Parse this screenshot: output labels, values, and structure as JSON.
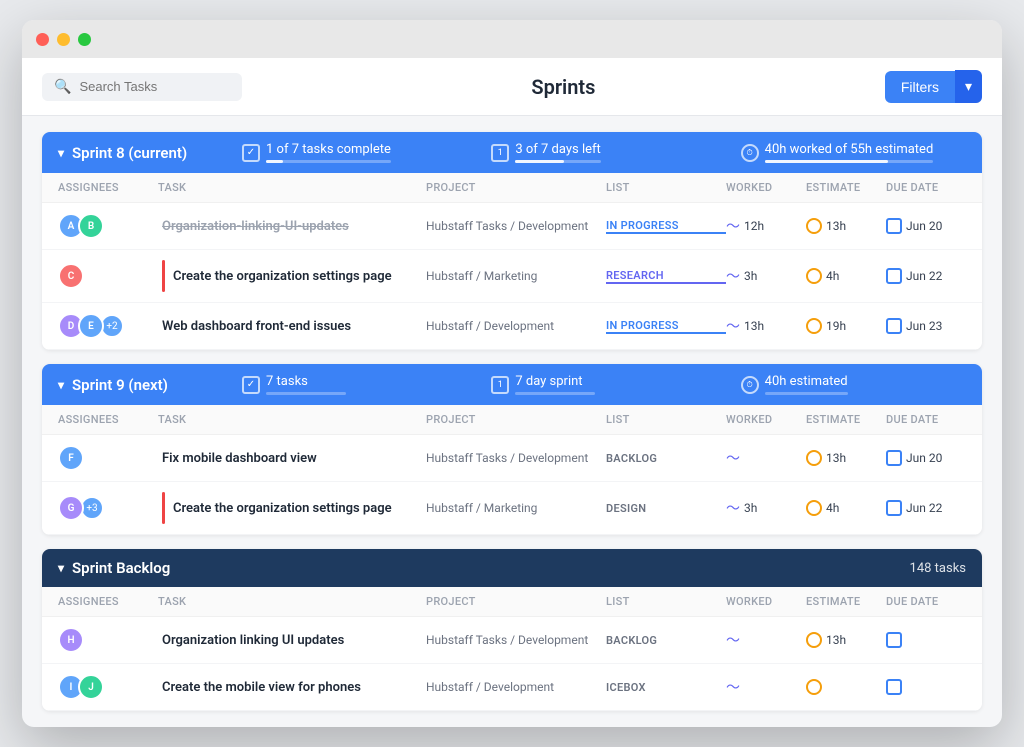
{
  "window": {
    "title": "Sprints"
  },
  "toolbar": {
    "search_placeholder": "Search Tasks",
    "page_title": "Sprints",
    "filters_label": "Filters",
    "chevron": "▾"
  },
  "sprints": [
    {
      "id": "sprint8",
      "title": "Sprint 8 (current)",
      "stats": [
        {
          "icon": "check",
          "text": "1 of 7 tasks complete",
          "bar_fill": 14
        },
        {
          "icon": "cal",
          "text": "3 of 7 days left",
          "bar_fill": 57
        },
        {
          "icon": "clock",
          "text": "40h worked of 55h estimated",
          "bar_fill": 73
        }
      ],
      "columns": [
        "Assignees",
        "Task",
        "Project",
        "List",
        "Worked",
        "Estimate",
        "Due Date"
      ],
      "rows": [
        {
          "assignees": [
            {
              "color": "#60a5fa",
              "initials": "A"
            },
            {
              "color": "#34d399",
              "initials": "B"
            }
          ],
          "extra": null,
          "priority": null,
          "task": "Organization-linking-UI-updates",
          "strikethrough": true,
          "project": "Hubstaff Tasks / Development",
          "list": "IN PROGRESS",
          "list_class": "in-progress",
          "worked": "12h",
          "estimate": "13h",
          "due_date": "Jun 20"
        },
        {
          "assignees": [
            {
              "color": "#f87171",
              "initials": "C"
            }
          ],
          "extra": null,
          "priority": "#ef4444",
          "task": "Create the organization settings page",
          "strikethrough": false,
          "project": "Hubstaff / Marketing",
          "list": "RESEARCH",
          "list_class": "research",
          "worked": "3h",
          "estimate": "4h",
          "due_date": "Jun 22"
        },
        {
          "assignees": [
            {
              "color": "#a78bfa",
              "initials": "D"
            },
            {
              "color": "#60a5fa",
              "initials": "E"
            }
          ],
          "extra": "+2",
          "priority": null,
          "task": "Web dashboard front-end issues",
          "strikethrough": false,
          "project": "Hubstaff / Development",
          "list": "IN PROGRESS",
          "list_class": "in-progress",
          "worked": "13h",
          "estimate": "19h",
          "due_date": "Jun 23"
        }
      ]
    },
    {
      "id": "sprint9",
      "title": "Sprint 9 (next)",
      "stats": [
        {
          "icon": "check",
          "text": "7 tasks",
          "bar_fill": 0
        },
        {
          "icon": "cal",
          "text": "7 day sprint",
          "bar_fill": 0
        },
        {
          "icon": "clock",
          "text": "40h estimated",
          "bar_fill": 0
        }
      ],
      "columns": [
        "Assignees",
        "Task",
        "Project",
        "List",
        "Worked",
        "Estimate",
        "Due Date"
      ],
      "rows": [
        {
          "assignees": [
            {
              "color": "#60a5fa",
              "initials": "F"
            }
          ],
          "extra": null,
          "priority": null,
          "task": "Fix mobile dashboard view",
          "strikethrough": false,
          "project": "Hubstaff Tasks / Development",
          "list": "BACKLOG",
          "list_class": "backlog",
          "worked": "",
          "estimate": "13h",
          "due_date": "Jun 20"
        },
        {
          "assignees": [
            {
              "color": "#a78bfa",
              "initials": "G"
            }
          ],
          "extra": "+3",
          "priority": "#ef4444",
          "task": "Create the organization settings page",
          "strikethrough": false,
          "project": "Hubstaff / Marketing",
          "list": "DESIGN",
          "list_class": "design",
          "worked": "3h",
          "estimate": "4h",
          "due_date": "Jun 22"
        }
      ]
    }
  ],
  "backlog": {
    "title": "Sprint Backlog",
    "count": "148 tasks",
    "columns": [
      "Assignees",
      "Task",
      "Project",
      "List",
      "Worked",
      "Estimate",
      "Due Date"
    ],
    "rows": [
      {
        "assignees": [
          {
            "color": "#a78bfa",
            "initials": "H"
          }
        ],
        "extra": null,
        "priority": null,
        "task": "Organization linking UI updates",
        "strikethrough": false,
        "project": "Hubstaff Tasks / Development",
        "list": "BACKLOG",
        "list_class": "backlog",
        "worked": "",
        "estimate": "13h",
        "due_date": ""
      },
      {
        "assignees": [
          {
            "color": "#60a5fa",
            "initials": "I"
          },
          {
            "color": "#34d399",
            "initials": "J"
          }
        ],
        "extra": null,
        "priority": null,
        "task": "Create the mobile view for phones",
        "strikethrough": false,
        "project": "Hubstaff / Development",
        "list": "ICEBOX",
        "list_class": "icebox",
        "worked": "",
        "estimate": "",
        "due_date": ""
      }
    ]
  }
}
